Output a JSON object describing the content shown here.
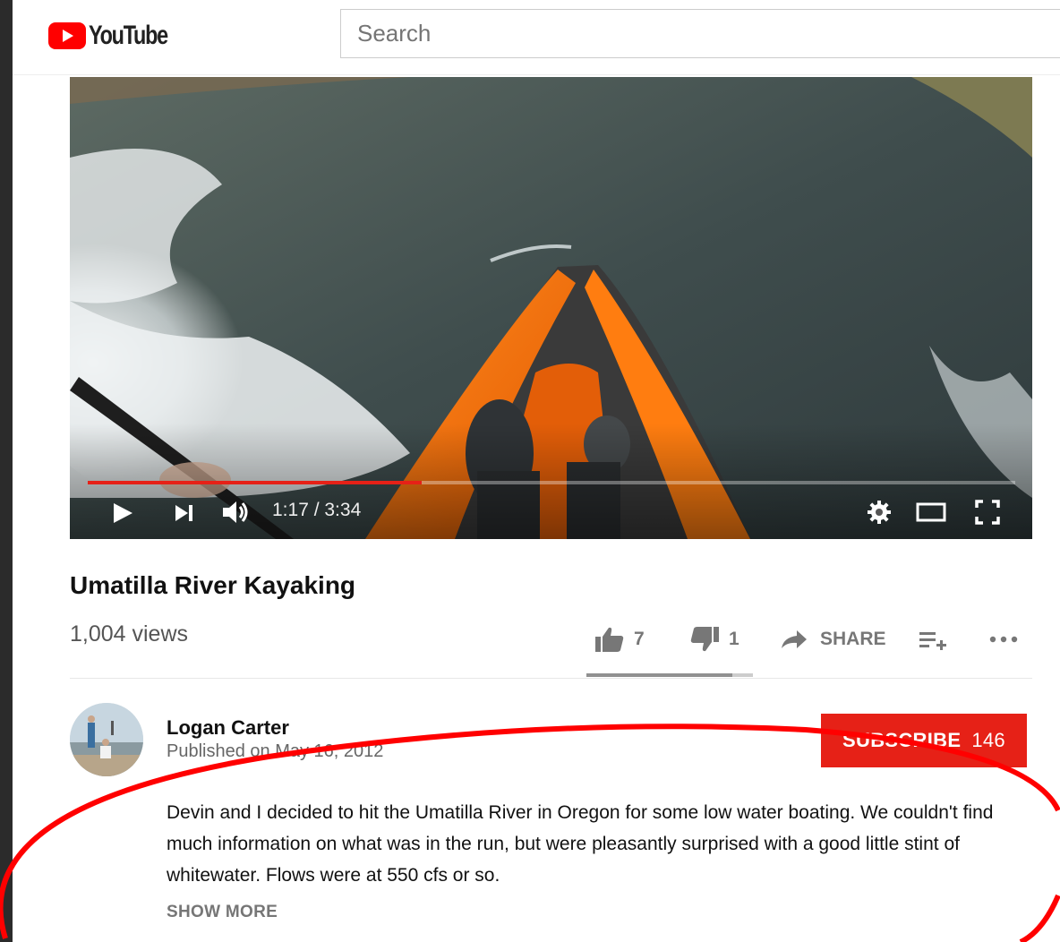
{
  "header": {
    "logo_text": "YouTube",
    "search_placeholder": "Search"
  },
  "player": {
    "progress_fraction": 0.36,
    "current_time": "1:17",
    "duration": "3:34",
    "time_display": "1:17 / 3:34",
    "icons": [
      "play-icon",
      "next-icon",
      "volume-icon",
      "settings-icon",
      "theater-mode-icon",
      "fullscreen-icon"
    ],
    "progress_color": "#e62117"
  },
  "video": {
    "title": "Umatilla River Kayaking",
    "views": "1,004 views",
    "likes": "7",
    "dislikes": "1",
    "share_label": "SHARE",
    "like_fraction": 0.875
  },
  "owner": {
    "name": "Logan Carter",
    "published": "Published on May 16, 2012",
    "subscribe_label": "SUBSCRIBE",
    "subscriber_count": "146",
    "subscribe_color": "#e62117"
  },
  "description": {
    "text": "Devin and I decided to hit the Umatilla River in Oregon for some low water boating.  We couldn't find much information on what was in the run, but were pleasantly surprised with a good little stint of whitewater.  Flows were at 550 cfs or so.",
    "show_more_label": "SHOW MORE"
  },
  "annotation": {
    "color": "#ff0000"
  }
}
